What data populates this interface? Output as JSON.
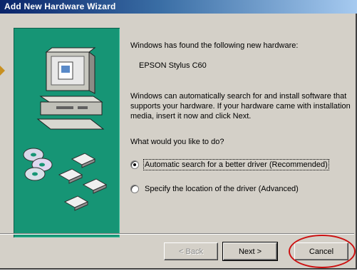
{
  "window": {
    "title": "Add New Hardware Wizard"
  },
  "content": {
    "found_text": "Windows has found the following new hardware:",
    "device_name": "EPSON Stylus C60",
    "explanation": "Windows can automatically search for and install software that supports your hardware. If your hardware came with installation media, insert it now and click Next.",
    "question": "What would you like to do?",
    "options": [
      {
        "label": "Automatic search for a better driver (Recommended)",
        "checked": true
      },
      {
        "label": "Specify the location of the driver (Advanced)",
        "checked": false
      }
    ]
  },
  "buttons": {
    "back": "< Back",
    "next": "Next >",
    "cancel": "Cancel"
  },
  "colors": {
    "titlebar_start": "#0a246a",
    "panel": "#169575",
    "annotation": "#cc1010"
  },
  "icons": {
    "illustration": "computer-with-discs-icon"
  }
}
